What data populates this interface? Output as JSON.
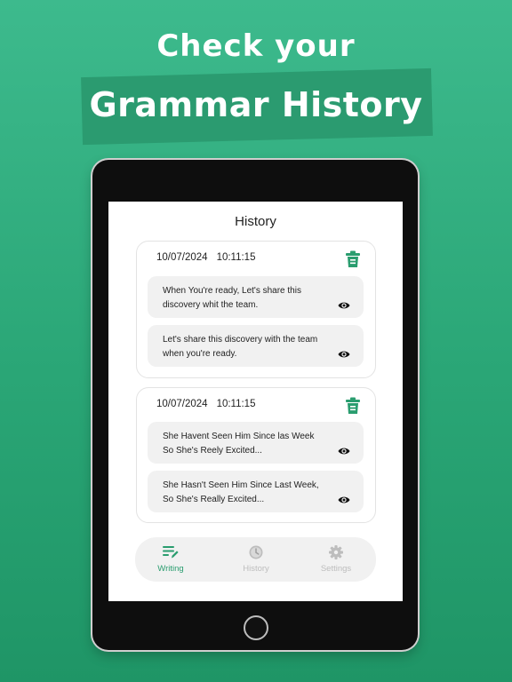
{
  "promo": {
    "headline_top": "Check your",
    "headline_main": "Grammar History"
  },
  "screen": {
    "title": "History"
  },
  "cards": [
    {
      "date": "10/07/2024",
      "time": "10:11:15",
      "entries": [
        {
          "text": "When You're ready, Let's share this discovery whit the team."
        },
        {
          "text": "Let's share this discovery with the team when you're ready."
        }
      ]
    },
    {
      "date": "10/07/2024",
      "time": "10:11:15",
      "entries": [
        {
          "text": "She Havent Seen Him Since las Week So She's Reely Excited..."
        },
        {
          "text": "She Hasn't Seen Him Since Last Week, So She's Really Excited..."
        }
      ]
    }
  ],
  "nav": {
    "items": [
      {
        "label": "Writing",
        "icon": "writing-icon",
        "active": true
      },
      {
        "label": "History",
        "icon": "clock-icon",
        "active": false
      },
      {
        "label": "Settings",
        "icon": "gear-icon",
        "active": false
      }
    ]
  },
  "colors": {
    "background": "#2aa676",
    "banner": "#2b9b70",
    "accent": "#2a9d6f",
    "inactive": "#bdbdbd"
  }
}
